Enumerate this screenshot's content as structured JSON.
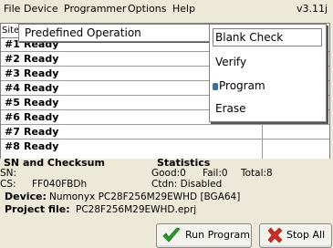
{
  "menu": {
    "items": [
      "File",
      "Device",
      "Programmer",
      "Options",
      "Help"
    ],
    "version": "v3.11j"
  },
  "site_header": "Site",
  "predefined": {
    "label": "Predefined Operation"
  },
  "context_menu": {
    "items": [
      "Blank Check",
      "Verify",
      "Program",
      "Erase"
    ],
    "selected": "Program"
  },
  "sites": [
    {
      "num": "#1",
      "status": "Ready"
    },
    {
      "num": "#2",
      "status": "Ready"
    },
    {
      "num": "#3",
      "status": "Ready"
    },
    {
      "num": "#4",
      "status": "Ready"
    },
    {
      "num": "#5",
      "status": "Ready"
    },
    {
      "num": "#6",
      "status": "Ready"
    },
    {
      "num": "#7",
      "status": "Ready"
    },
    {
      "num": "#8",
      "status": "Ready"
    }
  ],
  "sn_section": {
    "title": "SN and Checksum",
    "sn_label": "SN:",
    "sn_value": "",
    "cs_label": "CS:",
    "cs_value": "FF040FBDh"
  },
  "statistics": {
    "title": "Statistics",
    "good": "Good:0",
    "fail": "Fail:0",
    "total": "Total:8",
    "ctdn": "Ctdn: Disabled"
  },
  "device": {
    "label": "Device:",
    "value": "Numonyx PC28F256M29EWHD [BGA64]"
  },
  "project": {
    "label": "Project file:",
    "value": "PC28F256M29EWHD.eprj"
  },
  "buttons": {
    "run": "Run Program",
    "stop": "Stop All"
  },
  "colors": {
    "background": "#ece9d8",
    "check_green": "#2a9d2a",
    "stop_red": "#d22a1e",
    "selection": "#3a6ea5"
  }
}
